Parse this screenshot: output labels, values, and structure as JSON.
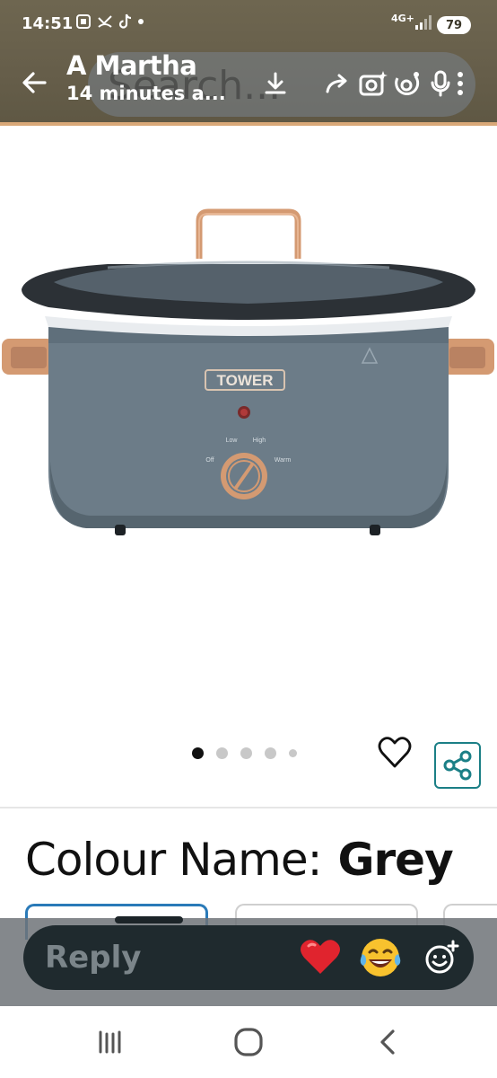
{
  "status_bar": {
    "time": "14:51",
    "network": "4G+",
    "battery": "79"
  },
  "header": {
    "search_placeholder": "Search...",
    "story_author": "A Martha",
    "story_time": "14 minutes a..."
  },
  "product": {
    "brand_on_image": "TOWER",
    "dial_labels": [
      "Low",
      "High",
      "Off",
      "Warm"
    ],
    "gallery": {
      "count": 5,
      "active_index": 0
    },
    "colour_label": "Colour Name:",
    "colour_value": "Grey"
  },
  "reply_bar": {
    "placeholder": "Reply",
    "quick_reactions": [
      "heart-emoji",
      "laughing-tears-emoji"
    ]
  },
  "colors": {
    "header_bg": "#665e4a",
    "accent_copper": "#d9a878",
    "share_teal": "#1b7f86",
    "selected_swatch": "#2a7ab8",
    "reply_bg": "#1f2a2e"
  },
  "icons": [
    "back-arrow-icon",
    "download-icon",
    "forward-share-icon",
    "camera-sparkle-icon",
    "lens-icon",
    "mic-icon",
    "more-vertical-icon",
    "heart-outline-icon",
    "share-icon",
    "add-emoji-icon",
    "recent-apps-icon",
    "home-icon",
    "nav-back-icon"
  ]
}
